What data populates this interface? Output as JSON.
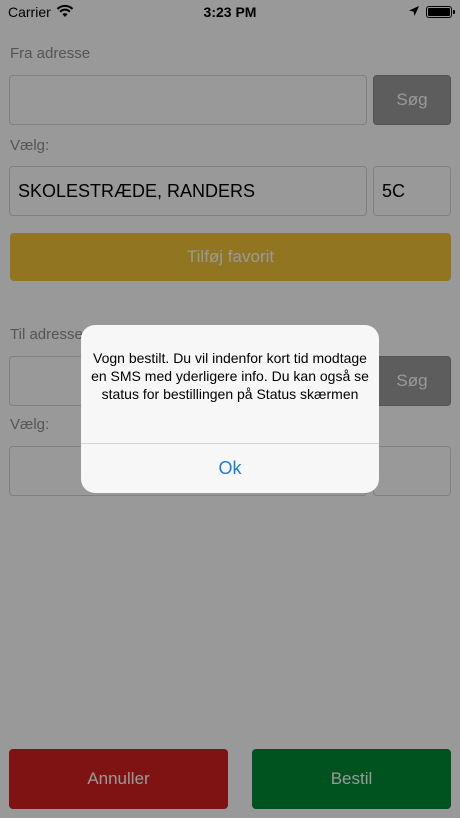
{
  "status_bar": {
    "carrier": "Carrier",
    "time": "3:23 PM"
  },
  "from": {
    "label": "Fra adresse",
    "input_value": "",
    "search_label": "Søg",
    "choose_label": "Vælg:",
    "street": "SKOLESTRÆDE, RANDERS",
    "number": "5C",
    "favorite_label": "Tilføj favorit"
  },
  "to": {
    "label": "Til adresse",
    "input_value": "",
    "search_label": "Søg",
    "choose_label": "Vælg:",
    "street": "",
    "number": ""
  },
  "footer": {
    "cancel_label": "Annuller",
    "order_label": "Bestil"
  },
  "alert": {
    "message": "Vogn bestilt. Du vil indenfor kort tid modtage en SMS med yderligere info. Du kan også se status for bestillingen på Status skærmen",
    "ok_label": "Ok"
  },
  "colors": {
    "favorite": "#f3c337",
    "cancel": "#d42121",
    "order": "#008a33",
    "search": "#9b9b9b",
    "link": "#1c7cd6"
  }
}
